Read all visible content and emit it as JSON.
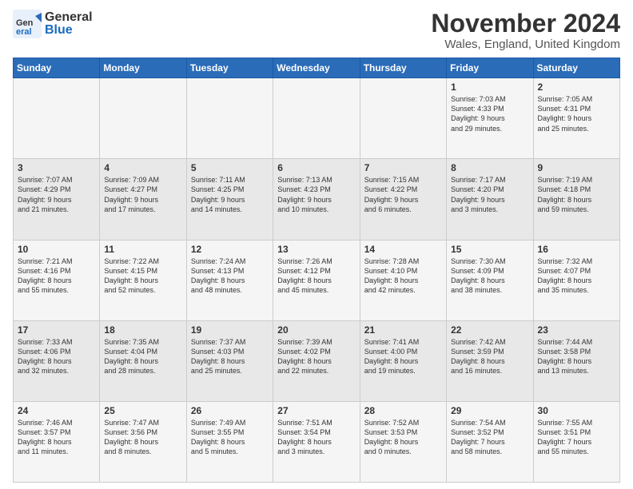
{
  "logo": {
    "general": "General",
    "blue": "Blue"
  },
  "title": "November 2024",
  "subtitle": "Wales, England, United Kingdom",
  "headers": [
    "Sunday",
    "Monday",
    "Tuesday",
    "Wednesday",
    "Thursday",
    "Friday",
    "Saturday"
  ],
  "weeks": [
    [
      {
        "day": "",
        "info": ""
      },
      {
        "day": "",
        "info": ""
      },
      {
        "day": "",
        "info": ""
      },
      {
        "day": "",
        "info": ""
      },
      {
        "day": "",
        "info": ""
      },
      {
        "day": "1",
        "info": "Sunrise: 7:03 AM\nSunset: 4:33 PM\nDaylight: 9 hours\nand 29 minutes."
      },
      {
        "day": "2",
        "info": "Sunrise: 7:05 AM\nSunset: 4:31 PM\nDaylight: 9 hours\nand 25 minutes."
      }
    ],
    [
      {
        "day": "3",
        "info": "Sunrise: 7:07 AM\nSunset: 4:29 PM\nDaylight: 9 hours\nand 21 minutes."
      },
      {
        "day": "4",
        "info": "Sunrise: 7:09 AM\nSunset: 4:27 PM\nDaylight: 9 hours\nand 17 minutes."
      },
      {
        "day": "5",
        "info": "Sunrise: 7:11 AM\nSunset: 4:25 PM\nDaylight: 9 hours\nand 14 minutes."
      },
      {
        "day": "6",
        "info": "Sunrise: 7:13 AM\nSunset: 4:23 PM\nDaylight: 9 hours\nand 10 minutes."
      },
      {
        "day": "7",
        "info": "Sunrise: 7:15 AM\nSunset: 4:22 PM\nDaylight: 9 hours\nand 6 minutes."
      },
      {
        "day": "8",
        "info": "Sunrise: 7:17 AM\nSunset: 4:20 PM\nDaylight: 9 hours\nand 3 minutes."
      },
      {
        "day": "9",
        "info": "Sunrise: 7:19 AM\nSunset: 4:18 PM\nDaylight: 8 hours\nand 59 minutes."
      }
    ],
    [
      {
        "day": "10",
        "info": "Sunrise: 7:21 AM\nSunset: 4:16 PM\nDaylight: 8 hours\nand 55 minutes."
      },
      {
        "day": "11",
        "info": "Sunrise: 7:22 AM\nSunset: 4:15 PM\nDaylight: 8 hours\nand 52 minutes."
      },
      {
        "day": "12",
        "info": "Sunrise: 7:24 AM\nSunset: 4:13 PM\nDaylight: 8 hours\nand 48 minutes."
      },
      {
        "day": "13",
        "info": "Sunrise: 7:26 AM\nSunset: 4:12 PM\nDaylight: 8 hours\nand 45 minutes."
      },
      {
        "day": "14",
        "info": "Sunrise: 7:28 AM\nSunset: 4:10 PM\nDaylight: 8 hours\nand 42 minutes."
      },
      {
        "day": "15",
        "info": "Sunrise: 7:30 AM\nSunset: 4:09 PM\nDaylight: 8 hours\nand 38 minutes."
      },
      {
        "day": "16",
        "info": "Sunrise: 7:32 AM\nSunset: 4:07 PM\nDaylight: 8 hours\nand 35 minutes."
      }
    ],
    [
      {
        "day": "17",
        "info": "Sunrise: 7:33 AM\nSunset: 4:06 PM\nDaylight: 8 hours\nand 32 minutes."
      },
      {
        "day": "18",
        "info": "Sunrise: 7:35 AM\nSunset: 4:04 PM\nDaylight: 8 hours\nand 28 minutes."
      },
      {
        "day": "19",
        "info": "Sunrise: 7:37 AM\nSunset: 4:03 PM\nDaylight: 8 hours\nand 25 minutes."
      },
      {
        "day": "20",
        "info": "Sunrise: 7:39 AM\nSunset: 4:02 PM\nDaylight: 8 hours\nand 22 minutes."
      },
      {
        "day": "21",
        "info": "Sunrise: 7:41 AM\nSunset: 4:00 PM\nDaylight: 8 hours\nand 19 minutes."
      },
      {
        "day": "22",
        "info": "Sunrise: 7:42 AM\nSunset: 3:59 PM\nDaylight: 8 hours\nand 16 minutes."
      },
      {
        "day": "23",
        "info": "Sunrise: 7:44 AM\nSunset: 3:58 PM\nDaylight: 8 hours\nand 13 minutes."
      }
    ],
    [
      {
        "day": "24",
        "info": "Sunrise: 7:46 AM\nSunset: 3:57 PM\nDaylight: 8 hours\nand 11 minutes."
      },
      {
        "day": "25",
        "info": "Sunrise: 7:47 AM\nSunset: 3:56 PM\nDaylight: 8 hours\nand 8 minutes."
      },
      {
        "day": "26",
        "info": "Sunrise: 7:49 AM\nSunset: 3:55 PM\nDaylight: 8 hours\nand 5 minutes."
      },
      {
        "day": "27",
        "info": "Sunrise: 7:51 AM\nSunset: 3:54 PM\nDaylight: 8 hours\nand 3 minutes."
      },
      {
        "day": "28",
        "info": "Sunrise: 7:52 AM\nSunset: 3:53 PM\nDaylight: 8 hours\nand 0 minutes."
      },
      {
        "day": "29",
        "info": "Sunrise: 7:54 AM\nSunset: 3:52 PM\nDaylight: 7 hours\nand 58 minutes."
      },
      {
        "day": "30",
        "info": "Sunrise: 7:55 AM\nSunset: 3:51 PM\nDaylight: 7 hours\nand 55 minutes."
      }
    ]
  ]
}
